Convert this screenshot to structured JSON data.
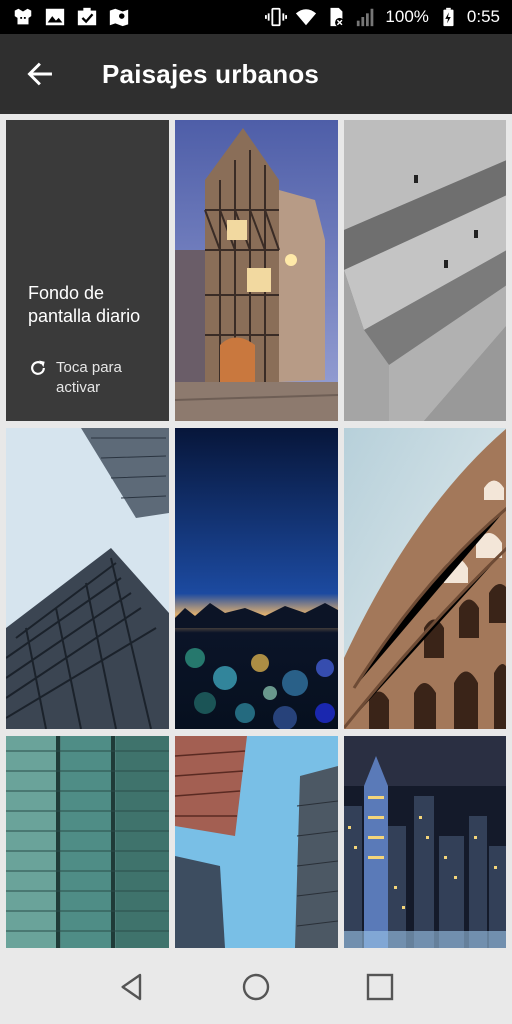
{
  "status_bar": {
    "battery_text": "100%",
    "time": "0:55"
  },
  "app_bar": {
    "title": "Paisajes urbanos"
  },
  "daily_tile": {
    "title": "Fondo de pantalla diario",
    "action_label": "Toca para activar"
  },
  "wallpapers": [
    {
      "subject": "half-timbered house at dusk"
    },
    {
      "subject": "concrete beams"
    },
    {
      "subject": "glass skyscraper"
    },
    {
      "subject": "city lights bokeh at night"
    },
    {
      "subject": "Colosseum"
    },
    {
      "subject": "glass tower facade"
    },
    {
      "subject": "skyscrapers against blue sky"
    },
    {
      "subject": "night skyline"
    }
  ],
  "colors": {
    "app_bar": "#2f2f2f",
    "daily_tile": "#3a3a3a",
    "status_bar": "#000000",
    "nav_bar": "#e9e9e9"
  }
}
